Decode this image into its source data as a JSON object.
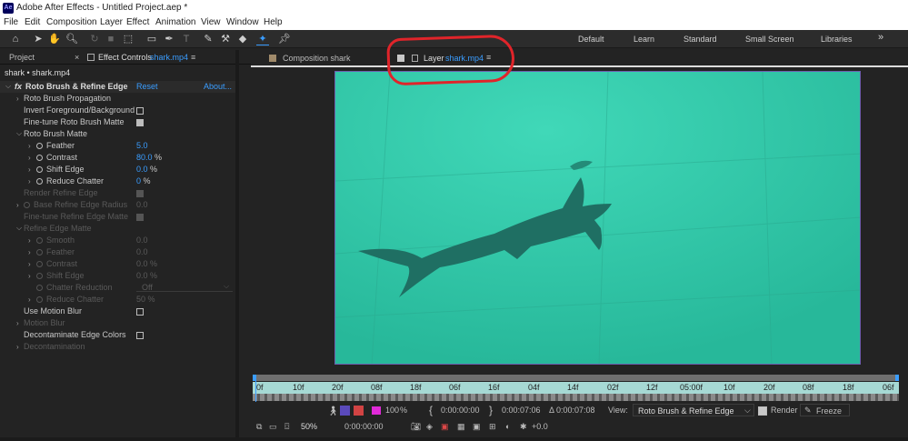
{
  "app": {
    "icon_label": "Ae",
    "title": "Adobe After Effects - Untitled Project.aep *"
  },
  "menu": [
    "File",
    "Edit",
    "Composition",
    "Layer",
    "Effect",
    "Animation",
    "View",
    "Window",
    "Help"
  ],
  "toolbar": {
    "tools": [
      "home-icon",
      "selection-arrow-icon",
      "hand-icon",
      "zoom-icon",
      "rotate-icon",
      "camera-icon",
      "pan-behind-icon",
      "rectangle-icon",
      "pen-icon",
      "type-icon",
      "brush-icon",
      "clone-stamp-icon",
      "eraser-icon",
      "roto-brush-icon",
      "puppet-pin-icon"
    ],
    "workspaces": [
      "Default",
      "Learn",
      "Standard",
      "Small Screen",
      "Libraries"
    ],
    "more": "»"
  },
  "left": {
    "tab_project": "Project",
    "tab_close": "×",
    "tab_effect_controls": "Effect Controls",
    "tab_effect_file": "shark.mp4",
    "breadcrumb": "shark • shark.mp4",
    "effect_name": "Roto Brush & Refine Edge",
    "reset": "Reset",
    "about": "About...",
    "fx": "fx",
    "rows": {
      "propagation": "Roto Brush Propagation",
      "invert": "Invert Foreground/Background",
      "finetune": "Fine-tune Roto Brush Matte",
      "matte": "Roto Brush Matte",
      "feather": "Feather",
      "feather_v": "5.0",
      "contrast": "Contrast",
      "contrast_v": "80.0",
      "contrast_u": "%",
      "shift": "Shift Edge",
      "shift_v": "0.0",
      "shift_u": "%",
      "chatter": "Reduce Chatter",
      "chatter_v": "0",
      "chatter_u": "%",
      "render_refine": "Render Refine Edge",
      "base_radius": "Base Refine Edge Radius",
      "base_radius_v": "0.0",
      "finetune_refine": "Fine-tune Refine Edge Matte",
      "refine_matte": "Refine Edge Matte",
      "smooth": "Smooth",
      "smooth_v": "0.0",
      "feather2": "Feather",
      "feather2_v": "0.0",
      "contrast2": "Contrast",
      "contrast2_v": "0.0 %",
      "shift2": "Shift Edge",
      "shift2_v": "0.0 %",
      "chatter_red": "Chatter Reduction",
      "chatter_red_v": "Off",
      "reduce2": "Reduce Chatter",
      "reduce2_v": "50 %",
      "motion_blur": "Use Motion Blur",
      "motion_blur_grp": "Motion Blur",
      "decontam": "Decontaminate Edge Colors",
      "decontamination": "Decontamination"
    }
  },
  "right": {
    "tab_comp": "Composition shark",
    "tab_layer": "Layer",
    "tab_layer_file": "shark.mp4",
    "ruler": [
      "0f",
      "10f",
      "20f",
      "08f",
      "18f",
      "06f",
      "16f",
      "04f",
      "14f",
      "02f",
      "12f",
      "05:00f",
      "10f",
      "20f",
      "08f",
      "18f",
      "06f"
    ],
    "zoom": "100",
    "zoom_unit": "%",
    "time_in": "0:00:00:00",
    "time_out": "0:00:07:06",
    "duration": "Δ 0:00:07:08",
    "view_label": "View:",
    "view_value": "Roto Brush & Refine Edge",
    "render_label": "Render",
    "freeze_label": "Freeze",
    "mag": "50%",
    "current_time": "0:00:00:00",
    "exposure": "+0.0"
  }
}
